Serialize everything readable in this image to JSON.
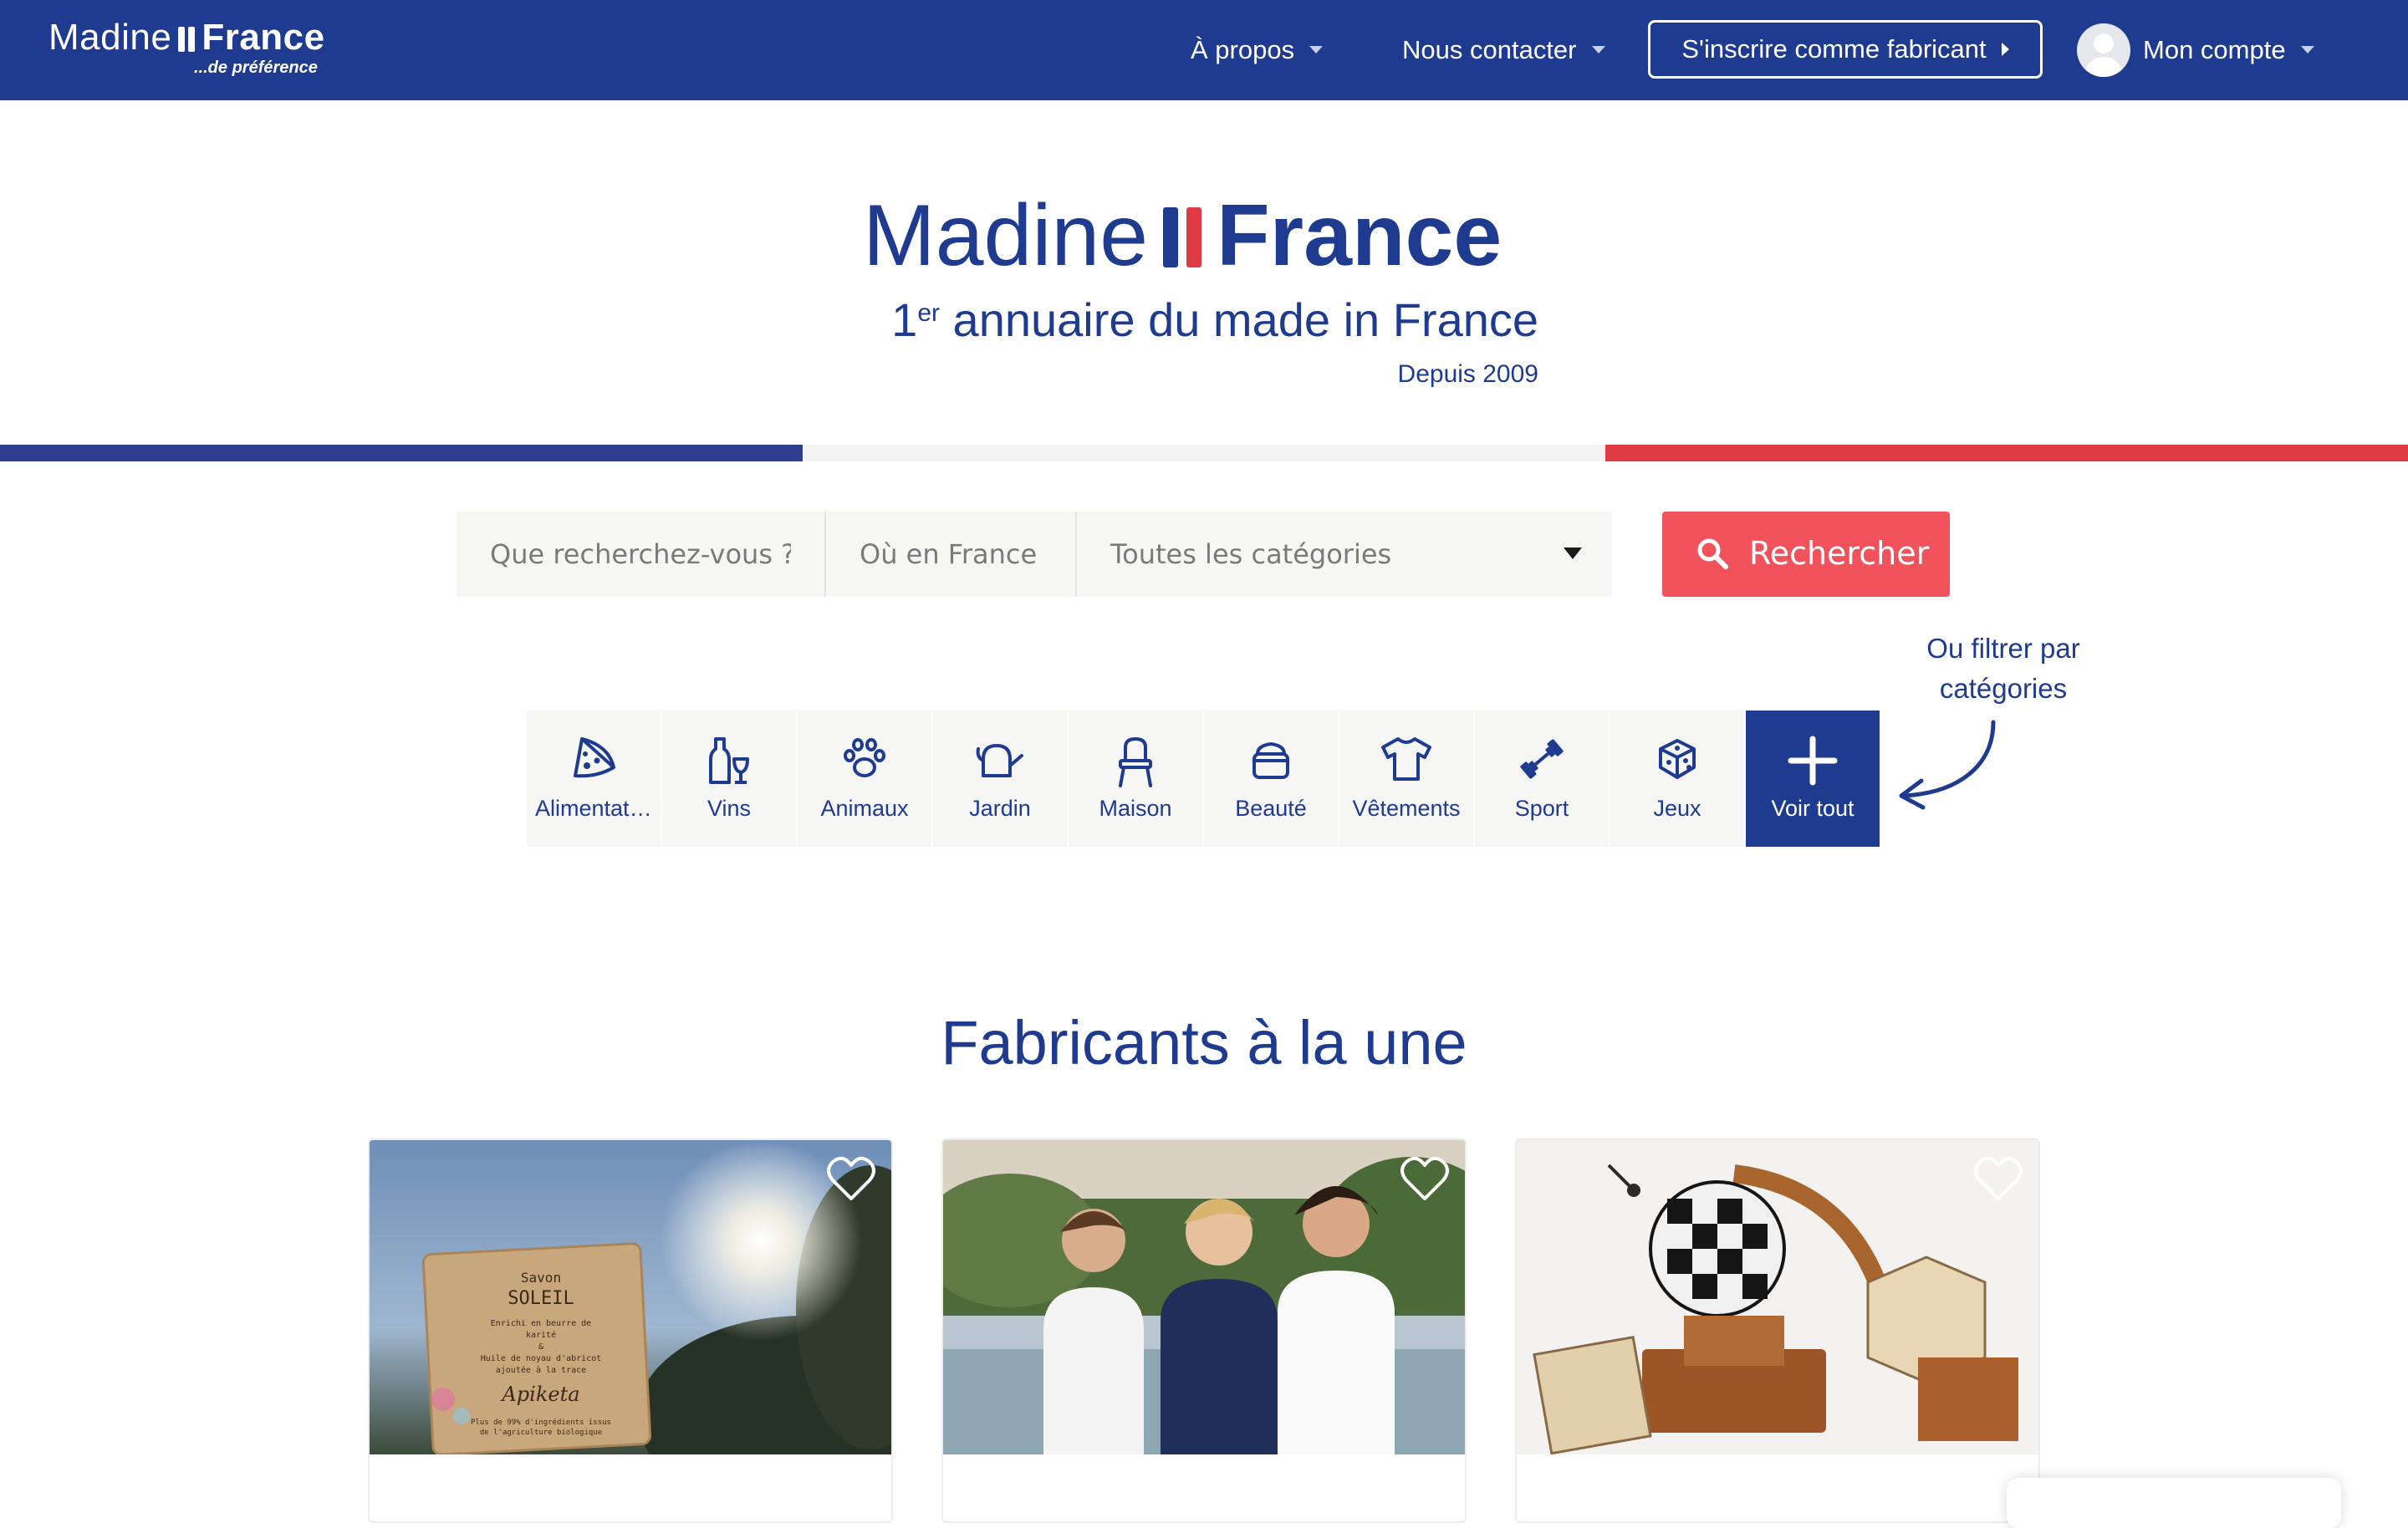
{
  "nav": {
    "logo_word1": "Madine",
    "logo_word2": "France",
    "logo_tagline": "...de préférence",
    "about": "À propos",
    "contact": "Nous contacter",
    "register": "S'inscrire comme fabricant",
    "account": "Mon compte"
  },
  "hero": {
    "logo_word1": "Madine",
    "logo_word2": "France",
    "subtitle_num": "1",
    "subtitle_sup": "er",
    "subtitle_rest": " annuaire du made in France",
    "since": "Depuis 2009"
  },
  "search": {
    "what_placeholder": "Que recherchez-vous ?",
    "where_placeholder": "Où en France",
    "category_selected": "Toutes les catégories",
    "button": "Rechercher"
  },
  "filter_hint": "Ou filtrer par catégories",
  "categories": [
    {
      "label": "Alimentati…",
      "icon": "pizza-icon"
    },
    {
      "label": "Vins",
      "icon": "wine-icon"
    },
    {
      "label": "Animaux",
      "icon": "paw-icon"
    },
    {
      "label": "Jardin",
      "icon": "watering-can-icon"
    },
    {
      "label": "Maison",
      "icon": "chair-icon"
    },
    {
      "label": "Beauté",
      "icon": "cream-jar-icon"
    },
    {
      "label": "Vêtements",
      "icon": "tshirt-icon"
    },
    {
      "label": "Sport",
      "icon": "dumbbell-icon"
    },
    {
      "label": "Jeux",
      "icon": "dice-icon"
    },
    {
      "label": "Voir tout",
      "icon": "plus-icon"
    }
  ],
  "featured": {
    "title": "Fabricants à la une",
    "cards": [
      {
        "image": "soap-product-photo",
        "soap_name": "Savon",
        "soap_title": "SOLEIL",
        "soap_text1": "Enrichi en beurre de",
        "soap_text2": "karité",
        "soap_text3": "&",
        "soap_text4": "Huile de noyau d'abricot",
        "soap_text5": "ajoutée à la trace",
        "soap_brand": "Apiketa",
        "soap_foot1": "Plus de 99% d'ingrédients issus",
        "soap_foot2": "de l'agriculture biologique"
      },
      {
        "image": "people-tshirts-photo"
      },
      {
        "image": "wooden-puzzles-photo"
      }
    ]
  },
  "colors": {
    "brand_blue": "#1f3b8f",
    "flag_red": "#dd3a44",
    "search_button": "#f2525b",
    "field_bg": "#f6f6f5"
  }
}
